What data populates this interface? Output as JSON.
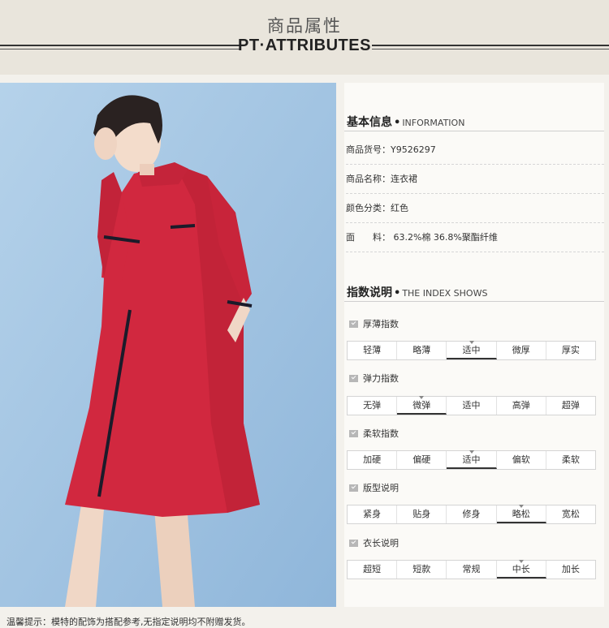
{
  "header": {
    "title_cn": "商品属性",
    "title_en": "PT·ATTRIBUTES"
  },
  "basic": {
    "heading_cn": "基本信息",
    "heading_dot": "•",
    "heading_en": "INFORMATION",
    "rows": [
      {
        "text": "商品货号：Y9526297"
      },
      {
        "text": "商品名称：连衣裙"
      },
      {
        "text": "颜色分类：红色"
      },
      {
        "text": "面　　料：  63.2%棉 36.8%聚酯纤维"
      }
    ]
  },
  "index": {
    "heading_cn": "指数说明",
    "heading_dot": "•",
    "heading_en": "THE INDEX SHOWS",
    "groups": [
      {
        "label": "厚薄指数",
        "options": [
          "轻薄",
          "略薄",
          "适中",
          "微厚",
          "厚实"
        ],
        "selected": 2
      },
      {
        "label": "弹力指数",
        "options": [
          "无弹",
          "微弹",
          "适中",
          "高弹",
          "超弹"
        ],
        "selected": 1
      },
      {
        "label": "柔软指数",
        "options": [
          "加硬",
          "偏硬",
          "适中",
          "偏软",
          "柔软"
        ],
        "selected": 2
      },
      {
        "label": "版型说明",
        "options": [
          "紧身",
          "贴身",
          "修身",
          "略松",
          "宽松"
        ],
        "selected": 3
      },
      {
        "label": "衣长说明",
        "options": [
          "超短",
          "短款",
          "常规",
          "中长",
          "加长"
        ],
        "selected": 3
      }
    ]
  },
  "footer": {
    "note": "温馨提示：模特的配饰为搭配参考,无指定说明均不附赠发货。"
  },
  "colors": {
    "dress": "#d1283f",
    "background": "#a9c8e3",
    "page": "#f3f1ec"
  }
}
